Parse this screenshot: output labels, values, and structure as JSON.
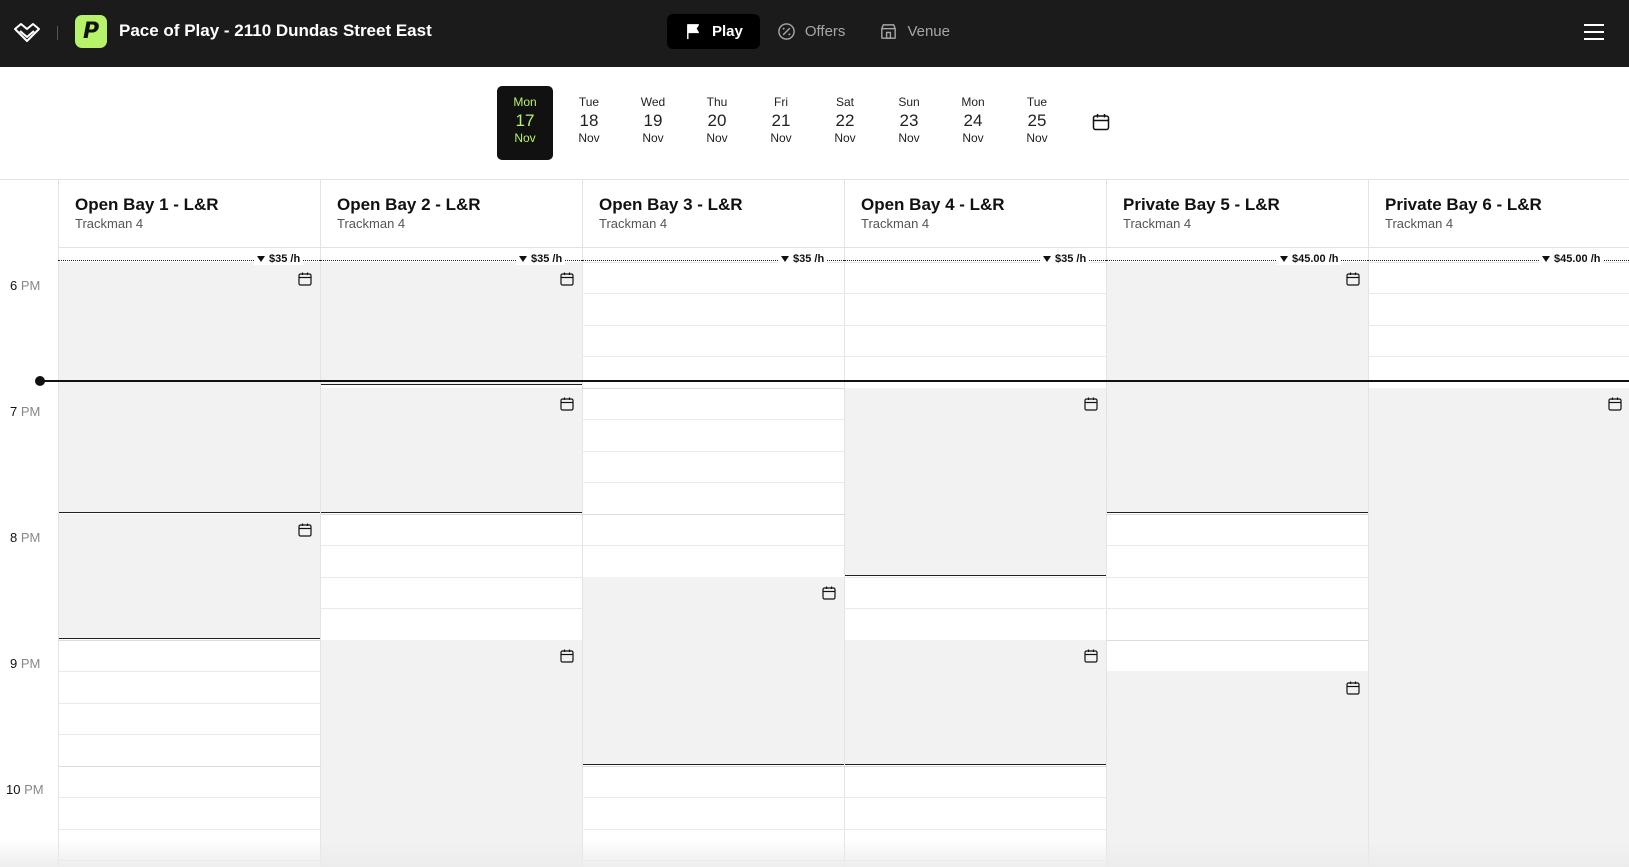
{
  "header": {
    "venue_initial": "P",
    "venue_title": "Pace of Play - 2110 Dundas Street East",
    "nav": [
      {
        "label": "Play",
        "icon": "flag-icon",
        "active": true
      },
      {
        "label": "Offers",
        "icon": "percent-badge-icon",
        "active": false
      },
      {
        "label": "Venue",
        "icon": "storefront-icon",
        "active": false
      }
    ]
  },
  "dates": [
    {
      "dow": "Mon",
      "num": "17",
      "mon": "Nov",
      "active": true
    },
    {
      "dow": "Tue",
      "num": "18",
      "mon": "Nov"
    },
    {
      "dow": "Wed",
      "num": "19",
      "mon": "Nov"
    },
    {
      "dow": "Thu",
      "num": "20",
      "mon": "Nov"
    },
    {
      "dow": "Fri",
      "num": "21",
      "mon": "Nov"
    },
    {
      "dow": "Sat",
      "num": "22",
      "mon": "Nov"
    },
    {
      "dow": "Sun",
      "num": "23",
      "mon": "Nov"
    },
    {
      "dow": "Mon",
      "num": "24",
      "mon": "Nov"
    },
    {
      "dow": "Tue",
      "num": "25",
      "mon": "Nov"
    }
  ],
  "resources": [
    {
      "name": "Open Bay 1 - L&R",
      "sub": "Trackman 4",
      "price": "$35 /h"
    },
    {
      "name": "Open Bay 2 - L&R",
      "sub": "Trackman 4",
      "price": "$35 /h"
    },
    {
      "name": "Open Bay 3 - L&R",
      "sub": "Trackman 4",
      "price": "$35 /h"
    },
    {
      "name": "Open Bay 4 - L&R",
      "sub": "Trackman 4",
      "price": "$35 /h"
    },
    {
      "name": "Private Bay 5 - L&R",
      "sub": "Trackman 4",
      "price": "$45.00 /h"
    },
    {
      "name": "Private Bay 6 - L&R",
      "sub": "Trackman 4",
      "price": "$45.00 /h"
    }
  ],
  "hours": [
    {
      "num": "6",
      "ampm": "PM"
    },
    {
      "num": "7",
      "ampm": "PM"
    },
    {
      "num": "8",
      "ampm": "PM"
    },
    {
      "num": "9",
      "ampm": "PM"
    },
    {
      "num": "10",
      "ampm": "PM"
    }
  ],
  "colors": {
    "accent": "#b6f26a",
    "header_bg": "#1b1b1b",
    "booked": "#f2f2f2"
  }
}
